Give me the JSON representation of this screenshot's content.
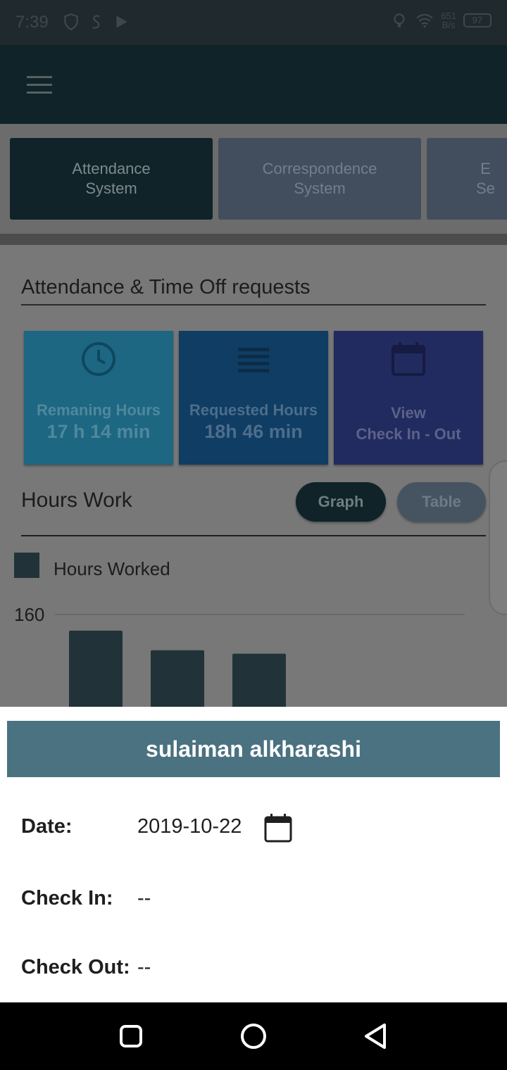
{
  "status_bar": {
    "time": "7:39",
    "net_speed_value": "651",
    "net_speed_unit": "B/s",
    "battery": "97"
  },
  "systems": {
    "tabs": [
      {
        "line1": "Attendance",
        "line2": "System"
      },
      {
        "line1": "Correspondence",
        "line2": "System"
      },
      {
        "line1": "E",
        "line2": "Se"
      }
    ]
  },
  "main": {
    "section_title": "Attendance & Time Off requests",
    "cards": {
      "remaining": {
        "label": "Remaning Hours",
        "value": "17 h 14 min",
        "icon": "clock-icon"
      },
      "requested": {
        "label": "Requested Hours",
        "value": "18h 46 min",
        "icon": "list-icon"
      },
      "view": {
        "line1": "View",
        "line2": "Check In - Out",
        "icon": "calendar-icon"
      }
    },
    "hours_title": "Hours Work",
    "toggle": {
      "graph": "Graph",
      "table": "Table"
    }
  },
  "chart_data": {
    "type": "bar",
    "legend": [
      "Hours Worked"
    ],
    "series": [
      {
        "name": "Hours Worked",
        "values": [
          146,
          129,
          126
        ]
      }
    ],
    "y_ticks": [
      "160"
    ],
    "ylim": [
      80,
      160
    ],
    "colors": {
      "bar": "#213338"
    }
  },
  "sheet": {
    "title": "sulaiman alkharashi",
    "date_label": "Date:",
    "date_value": "2019-10-22",
    "checkin_label": "Check In:",
    "checkin_value": "--",
    "checkout_label": "Check Out:",
    "checkout_value": "--"
  },
  "colors": {
    "header": "#0f2328",
    "sheet_header": "#4a7280",
    "card_remaining": "#1d6782",
    "card_requested": "#0f3d63",
    "card_view": "#222b60"
  }
}
